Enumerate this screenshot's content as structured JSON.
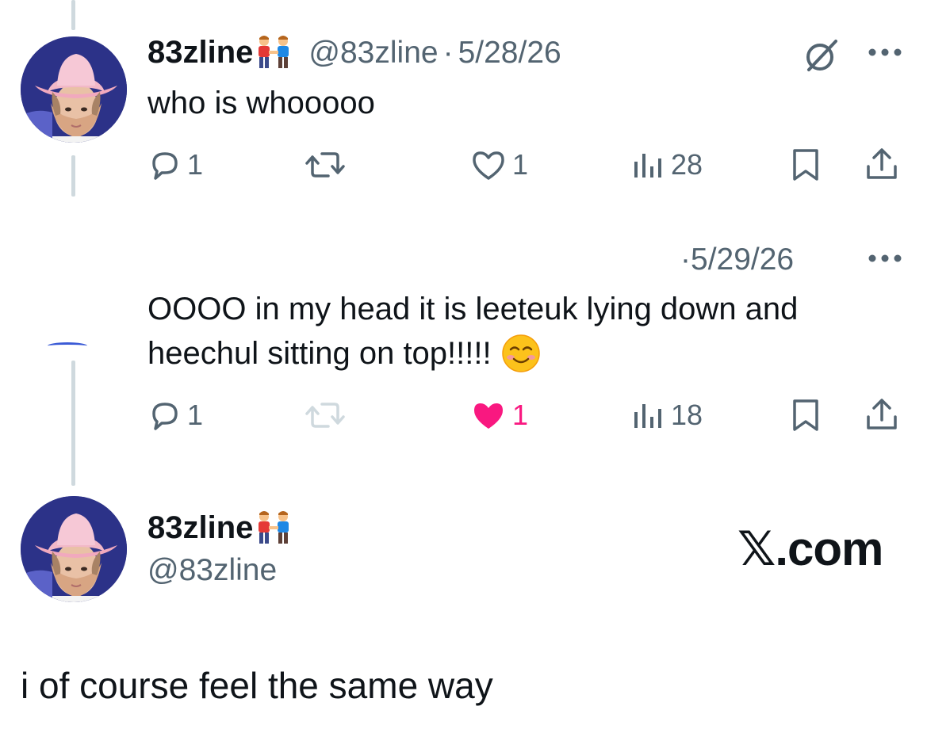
{
  "tweet1": {
    "display_name": "83zline",
    "handle": "@83zline",
    "separator": "·",
    "date": "5/28/26",
    "text": "who is whooooo",
    "replies": "1",
    "likes": "1",
    "views": "28"
  },
  "tweet2": {
    "separator": "·",
    "date": "5/29/26",
    "text_line1": "OOOO in my head it is leeteuk lying down and",
    "text_line2": "heechul sitting on top!!!!!",
    "replies": "1",
    "likes": "1",
    "views": "18",
    "like_color": "#f91880"
  },
  "profile": {
    "display_name": "83zline",
    "handle": "@83zline",
    "watermark": "𝕏.com"
  },
  "caption": "i of course feel the same way",
  "icons": {
    "emoji_name_badge": "two-men-holding-hands-icon",
    "grok": "grok-icon",
    "more": "more-dots-icon",
    "reply": "reply-icon",
    "repost": "repost-icon",
    "like": "heart-icon",
    "views": "views-icon",
    "bookmark": "bookmark-icon",
    "share": "share-icon",
    "emoji_smile": "smiling-face-icon"
  },
  "colors": {
    "text": "#0f1419",
    "secondary": "#536471",
    "thread_line": "#cfd9de",
    "like_active": "#f91880"
  }
}
